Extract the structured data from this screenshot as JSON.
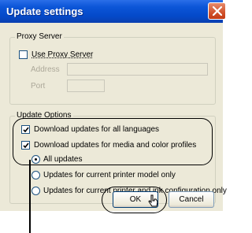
{
  "window": {
    "title": "Update settings",
    "close_icon": "close-icon"
  },
  "proxy": {
    "group_title": "Proxy Server",
    "use_proxy_label": "Use Proxy Server",
    "use_proxy_checked": false,
    "address_label": "Address",
    "address_value": "",
    "port_label": "Port",
    "port_value": ""
  },
  "update_options": {
    "group_title": "Update Options",
    "all_languages_label": "Download updates for all languages",
    "all_languages_checked": true,
    "media_profiles_label": "Download updates for media and color profiles",
    "media_profiles_checked": true,
    "all_updates_label": "All updates",
    "current_model_label": "Updates for current printer model only",
    "current_ink_label": "Updates for current printer and ink configuration only",
    "selected_option": "All updates"
  },
  "buttons": {
    "ok_label": "OK",
    "cancel_label": "Cancel"
  },
  "colors": {
    "titlebar": "#0449c9",
    "dialog_bg": "#ece9d8",
    "close_button": "#d1532d"
  }
}
